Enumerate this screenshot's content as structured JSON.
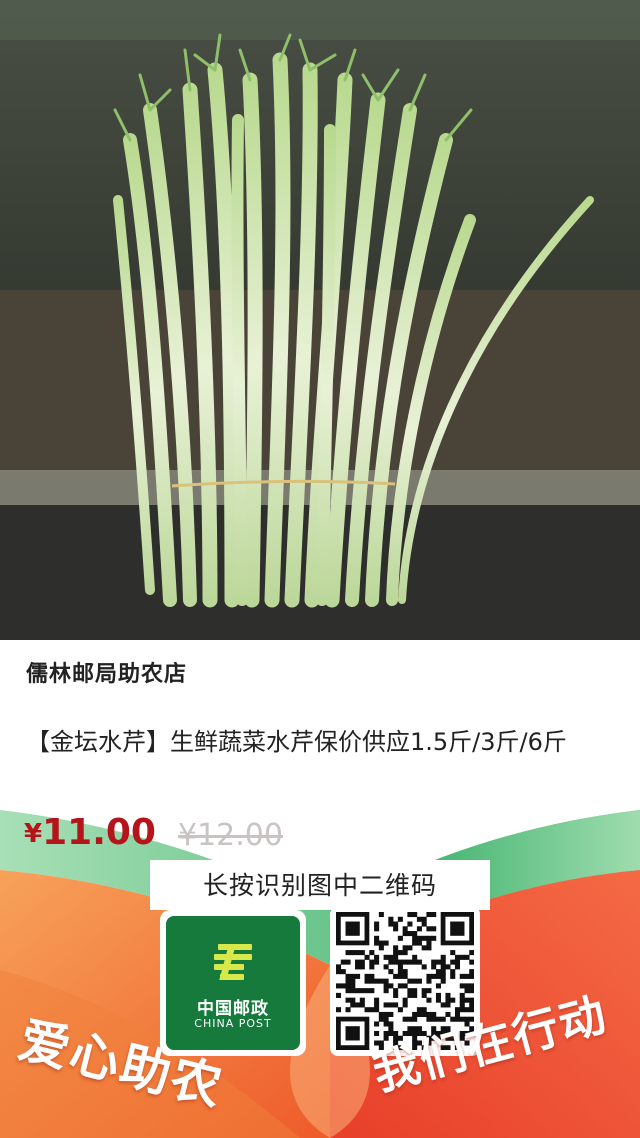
{
  "product_image": {
    "subject": "water-celery-bundle"
  },
  "store": {
    "name": "儒林邮局助农店"
  },
  "product": {
    "title": "【金坛水芹】生鲜蔬菜水芹保价供应1.5斤/3斤/6斤",
    "currency_symbol": "¥",
    "price": "11.00",
    "original_price": "¥12.00"
  },
  "poster": {
    "qr_hint": "长按识别图中二维码",
    "logo_cn": "中国邮政",
    "logo_en": "CHINA POST",
    "slogan_left": "爱心助农",
    "slogan_right": "我们在行动"
  },
  "colors": {
    "price_red": "#b6141b",
    "china_post_green": "#167a3c",
    "banner_orange": "#f4732a",
    "banner_green": "#1aa255"
  }
}
